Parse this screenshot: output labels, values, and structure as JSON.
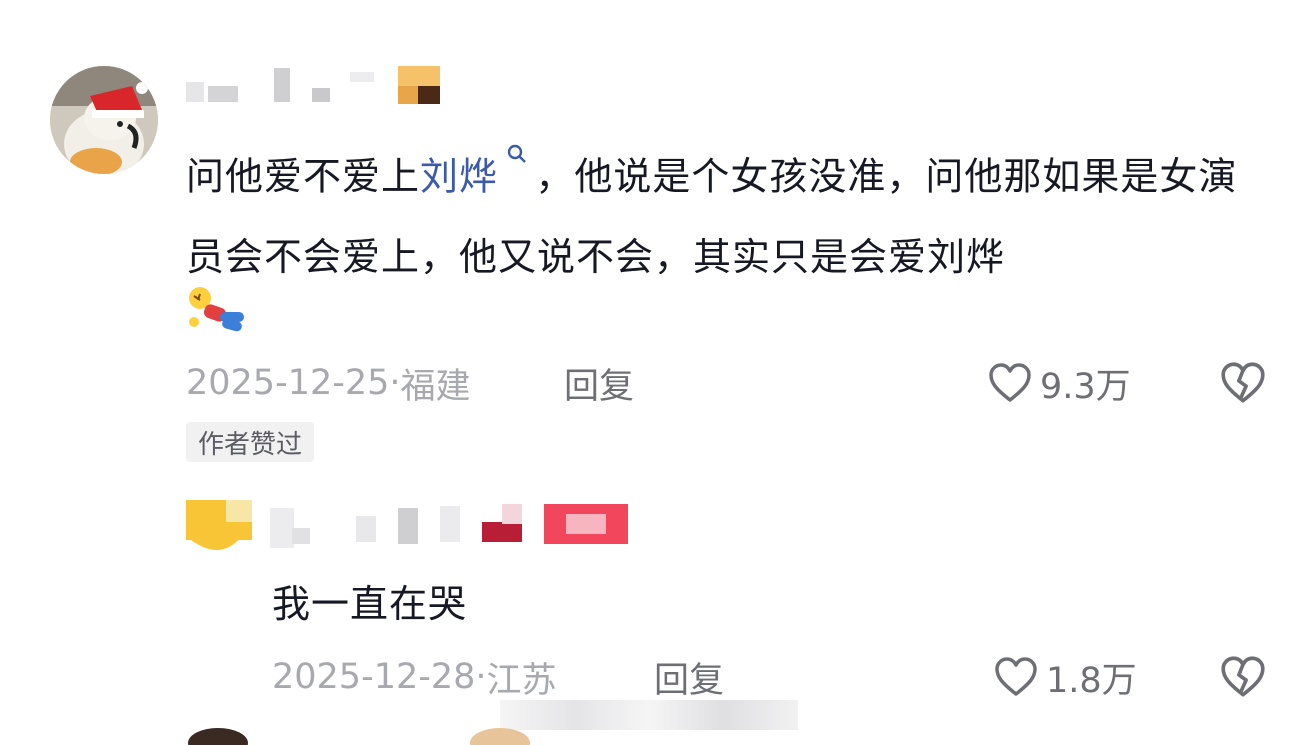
{
  "comment": {
    "text_before": "问他爱不爱上",
    "mention": "刘烨",
    "text_after": "，他说是个女孩没准，问他那如果是女演员会不会爱上，他又说不会，其实只是会爱刘烨",
    "date": "2025-12-25",
    "separator": "·",
    "location": "福建",
    "reply_label": "回复",
    "like_count": "9.3万",
    "badge": "作者赞过",
    "icons": {
      "search": "search-icon",
      "like": "heart-outline-icon",
      "dislike": "broken-heart-icon",
      "emoji": "fallen-person-emoji"
    }
  },
  "reply": {
    "text": "我一直在哭",
    "date": "2025-12-28",
    "separator": "·",
    "location": "江苏",
    "reply_label": "回复",
    "like_count": "1.8万"
  },
  "colors": {
    "text": "#161823",
    "mention": "#3b5aa8",
    "meta": "#a8a9ae",
    "action": "#6e6f75",
    "badge_bg": "#f1f1f2"
  }
}
